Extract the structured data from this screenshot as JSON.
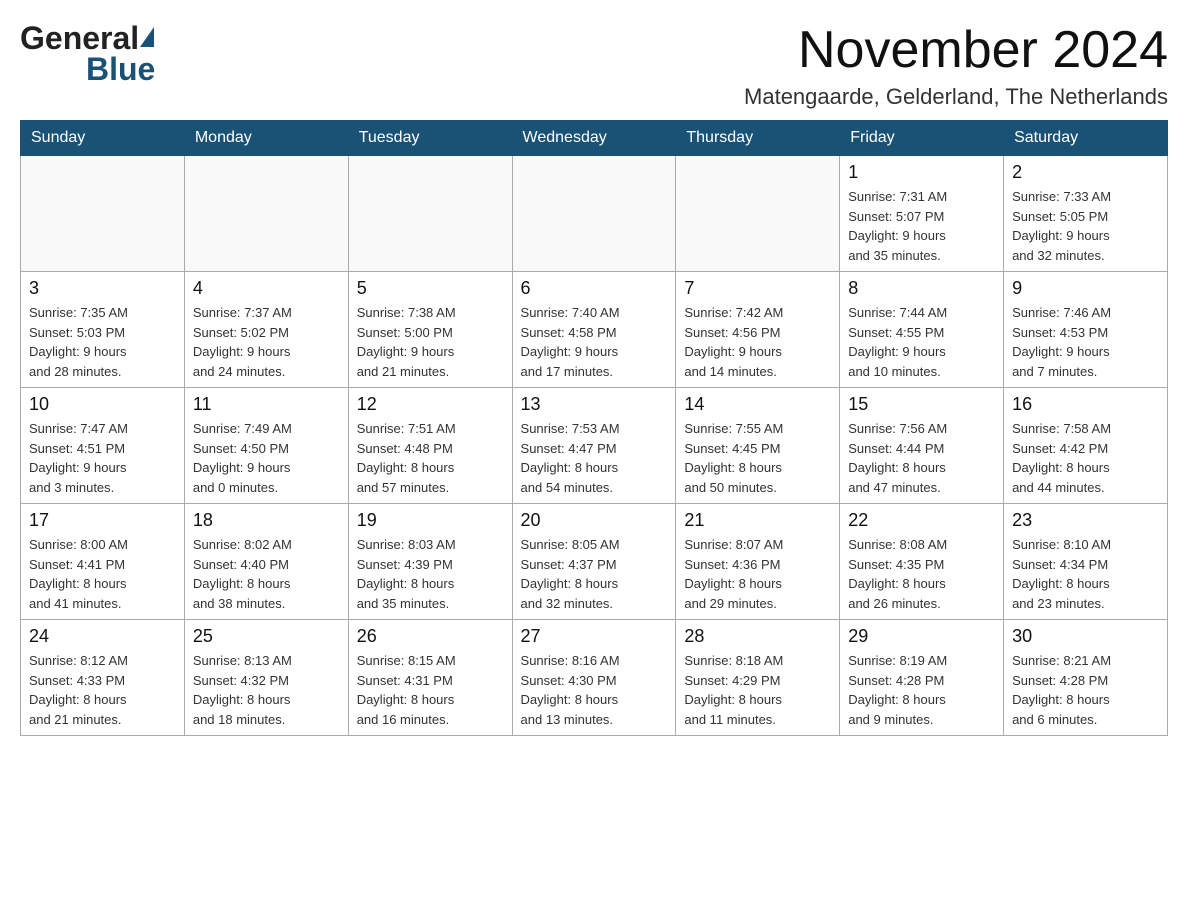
{
  "header": {
    "logo_general": "General",
    "logo_blue": "Blue",
    "main_title": "November 2024",
    "subtitle": "Matengaarde, Gelderland, The Netherlands"
  },
  "calendar": {
    "days_of_week": [
      "Sunday",
      "Monday",
      "Tuesday",
      "Wednesday",
      "Thursday",
      "Friday",
      "Saturday"
    ],
    "weeks": [
      [
        {
          "day": "",
          "info": ""
        },
        {
          "day": "",
          "info": ""
        },
        {
          "day": "",
          "info": ""
        },
        {
          "day": "",
          "info": ""
        },
        {
          "day": "",
          "info": ""
        },
        {
          "day": "1",
          "info": "Sunrise: 7:31 AM\nSunset: 5:07 PM\nDaylight: 9 hours\nand 35 minutes."
        },
        {
          "day": "2",
          "info": "Sunrise: 7:33 AM\nSunset: 5:05 PM\nDaylight: 9 hours\nand 32 minutes."
        }
      ],
      [
        {
          "day": "3",
          "info": "Sunrise: 7:35 AM\nSunset: 5:03 PM\nDaylight: 9 hours\nand 28 minutes."
        },
        {
          "day": "4",
          "info": "Sunrise: 7:37 AM\nSunset: 5:02 PM\nDaylight: 9 hours\nand 24 minutes."
        },
        {
          "day": "5",
          "info": "Sunrise: 7:38 AM\nSunset: 5:00 PM\nDaylight: 9 hours\nand 21 minutes."
        },
        {
          "day": "6",
          "info": "Sunrise: 7:40 AM\nSunset: 4:58 PM\nDaylight: 9 hours\nand 17 minutes."
        },
        {
          "day": "7",
          "info": "Sunrise: 7:42 AM\nSunset: 4:56 PM\nDaylight: 9 hours\nand 14 minutes."
        },
        {
          "day": "8",
          "info": "Sunrise: 7:44 AM\nSunset: 4:55 PM\nDaylight: 9 hours\nand 10 minutes."
        },
        {
          "day": "9",
          "info": "Sunrise: 7:46 AM\nSunset: 4:53 PM\nDaylight: 9 hours\nand 7 minutes."
        }
      ],
      [
        {
          "day": "10",
          "info": "Sunrise: 7:47 AM\nSunset: 4:51 PM\nDaylight: 9 hours\nand 3 minutes."
        },
        {
          "day": "11",
          "info": "Sunrise: 7:49 AM\nSunset: 4:50 PM\nDaylight: 9 hours\nand 0 minutes."
        },
        {
          "day": "12",
          "info": "Sunrise: 7:51 AM\nSunset: 4:48 PM\nDaylight: 8 hours\nand 57 minutes."
        },
        {
          "day": "13",
          "info": "Sunrise: 7:53 AM\nSunset: 4:47 PM\nDaylight: 8 hours\nand 54 minutes."
        },
        {
          "day": "14",
          "info": "Sunrise: 7:55 AM\nSunset: 4:45 PM\nDaylight: 8 hours\nand 50 minutes."
        },
        {
          "day": "15",
          "info": "Sunrise: 7:56 AM\nSunset: 4:44 PM\nDaylight: 8 hours\nand 47 minutes."
        },
        {
          "day": "16",
          "info": "Sunrise: 7:58 AM\nSunset: 4:42 PM\nDaylight: 8 hours\nand 44 minutes."
        }
      ],
      [
        {
          "day": "17",
          "info": "Sunrise: 8:00 AM\nSunset: 4:41 PM\nDaylight: 8 hours\nand 41 minutes."
        },
        {
          "day": "18",
          "info": "Sunrise: 8:02 AM\nSunset: 4:40 PM\nDaylight: 8 hours\nand 38 minutes."
        },
        {
          "day": "19",
          "info": "Sunrise: 8:03 AM\nSunset: 4:39 PM\nDaylight: 8 hours\nand 35 minutes."
        },
        {
          "day": "20",
          "info": "Sunrise: 8:05 AM\nSunset: 4:37 PM\nDaylight: 8 hours\nand 32 minutes."
        },
        {
          "day": "21",
          "info": "Sunrise: 8:07 AM\nSunset: 4:36 PM\nDaylight: 8 hours\nand 29 minutes."
        },
        {
          "day": "22",
          "info": "Sunrise: 8:08 AM\nSunset: 4:35 PM\nDaylight: 8 hours\nand 26 minutes."
        },
        {
          "day": "23",
          "info": "Sunrise: 8:10 AM\nSunset: 4:34 PM\nDaylight: 8 hours\nand 23 minutes."
        }
      ],
      [
        {
          "day": "24",
          "info": "Sunrise: 8:12 AM\nSunset: 4:33 PM\nDaylight: 8 hours\nand 21 minutes."
        },
        {
          "day": "25",
          "info": "Sunrise: 8:13 AM\nSunset: 4:32 PM\nDaylight: 8 hours\nand 18 minutes."
        },
        {
          "day": "26",
          "info": "Sunrise: 8:15 AM\nSunset: 4:31 PM\nDaylight: 8 hours\nand 16 minutes."
        },
        {
          "day": "27",
          "info": "Sunrise: 8:16 AM\nSunset: 4:30 PM\nDaylight: 8 hours\nand 13 minutes."
        },
        {
          "day": "28",
          "info": "Sunrise: 8:18 AM\nSunset: 4:29 PM\nDaylight: 8 hours\nand 11 minutes."
        },
        {
          "day": "29",
          "info": "Sunrise: 8:19 AM\nSunset: 4:28 PM\nDaylight: 8 hours\nand 9 minutes."
        },
        {
          "day": "30",
          "info": "Sunrise: 8:21 AM\nSunset: 4:28 PM\nDaylight: 8 hours\nand 6 minutes."
        }
      ]
    ]
  }
}
